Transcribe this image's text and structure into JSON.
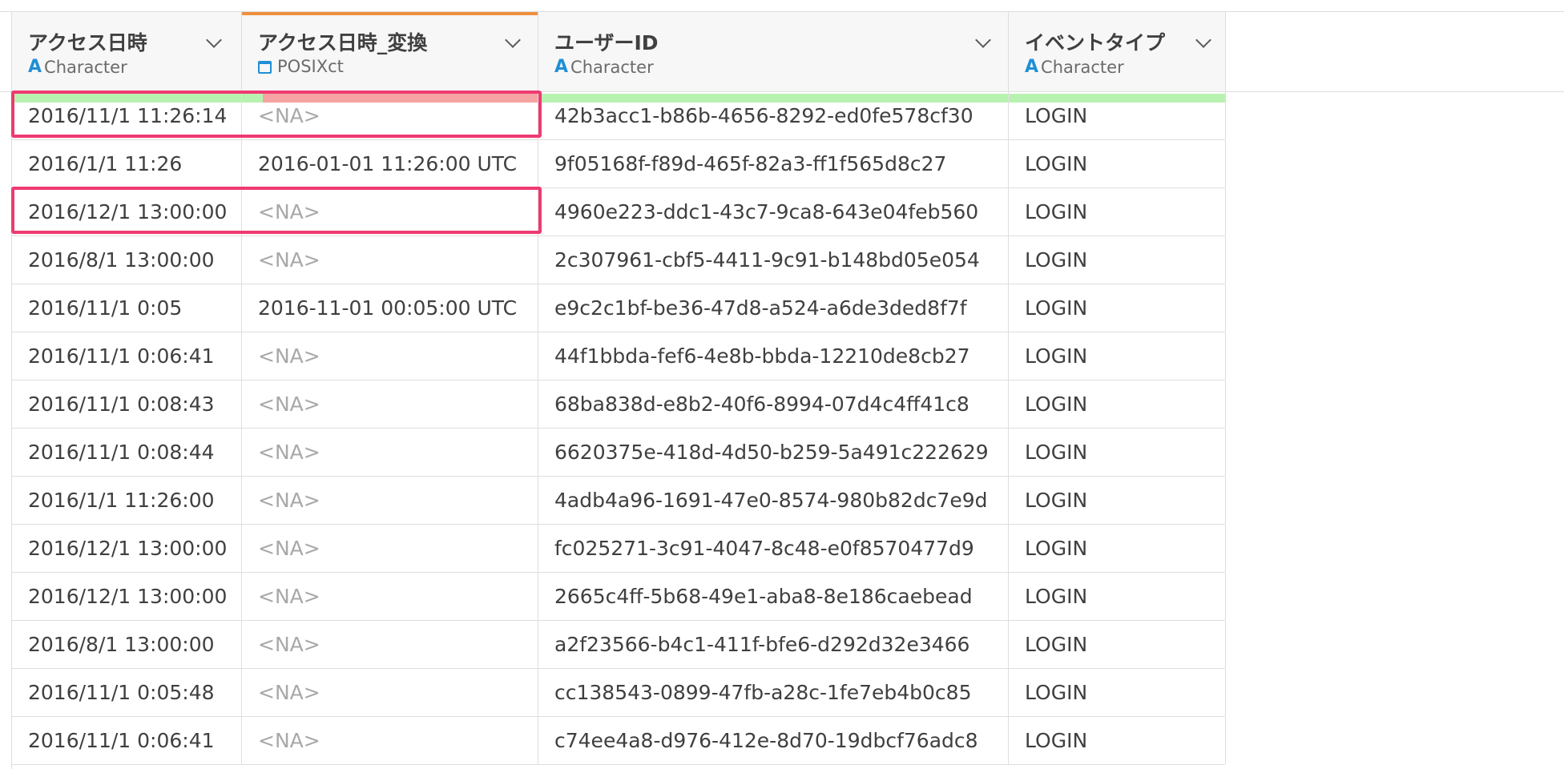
{
  "columns": [
    {
      "name": "アクセス日時",
      "type": "Character",
      "type_icon": "character-icon"
    },
    {
      "name": "アクセス日時_変換",
      "type": "POSIXct",
      "type_icon": "calendar-icon"
    },
    {
      "name": "ユーザーID",
      "type": "Character",
      "type_icon": "character-icon"
    },
    {
      "name": "イベントタイプ",
      "type": "Character",
      "type_icon": "character-icon"
    }
  ],
  "type_glyph": "A",
  "colors": {
    "accent_selected": "#ee8f3e",
    "valid_bar": "#b8f2b0",
    "na_bar": "#f5a3a3",
    "highlight": "#ef3a72",
    "type_icon": "#1f8fd6"
  },
  "na_fraction_col2": 0.93,
  "rows": [
    [
      "2016/11/1 11:26:14",
      "<NA>",
      "42b3acc1-b86b-4656-8292-ed0fe578cf30",
      "LOGIN"
    ],
    [
      "2016/1/1 11:26",
      "2016-01-01 11:26:00 UTC",
      "9f05168f-f89d-465f-82a3-ff1f565d8c27",
      "LOGIN"
    ],
    [
      "2016/12/1 13:00:00",
      "<NA>",
      "4960e223-ddc1-43c7-9ca8-643e04feb560",
      "LOGIN"
    ],
    [
      "2016/8/1 13:00:00",
      "<NA>",
      "2c307961-cbf5-4411-9c91-b148bd05e054",
      "LOGIN"
    ],
    [
      "2016/11/1 0:05",
      "2016-11-01 00:05:00 UTC",
      "e9c2c1bf-be36-47d8-a524-a6de3ded8f7f",
      "LOGIN"
    ],
    [
      "2016/11/1 0:06:41",
      "<NA>",
      "44f1bbda-fef6-4e8b-bbda-12210de8cb27",
      "LOGIN"
    ],
    [
      "2016/11/1 0:08:43",
      "<NA>",
      "68ba838d-e8b2-40f6-8994-07d4c4ff41c8",
      "LOGIN"
    ],
    [
      "2016/11/1 0:08:44",
      "<NA>",
      "6620375e-418d-4d50-b259-5a491c222629",
      "LOGIN"
    ],
    [
      "2016/1/1 11:26:00",
      "<NA>",
      "4adb4a96-1691-47e0-8574-980b82dc7e9d",
      "LOGIN"
    ],
    [
      "2016/12/1 13:00:00",
      "<NA>",
      "fc025271-3c91-4047-8c48-e0f8570477d9",
      "LOGIN"
    ],
    [
      "2016/12/1 13:00:00",
      "<NA>",
      "2665c4ff-5b68-49e1-aba8-8e186caebead",
      "LOGIN"
    ],
    [
      "2016/8/1 13:00:00",
      "<NA>",
      "a2f23566-b4c1-411f-bfe6-d292d32e3466",
      "LOGIN"
    ],
    [
      "2016/11/1 0:05:48",
      "<NA>",
      "cc138543-0899-47fb-a28c-1fe7eb4b0c85",
      "LOGIN"
    ],
    [
      "2016/11/1 0:06:41",
      "<NA>",
      "c74ee4a8-d976-412e-8d70-19dbcf76adc8",
      "LOGIN"
    ]
  ],
  "highlighted_rows": [
    0,
    2
  ]
}
